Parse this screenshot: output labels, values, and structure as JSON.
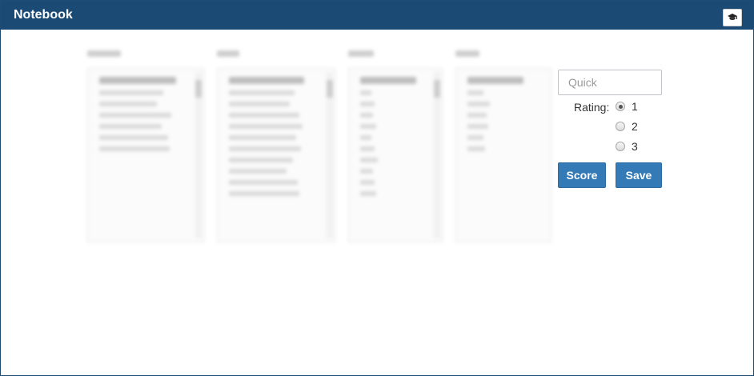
{
  "window": {
    "title": "Notebook"
  },
  "header": {
    "action_icon": "graduation-cap-icon"
  },
  "quick": {
    "placeholder": "Quick",
    "value": ""
  },
  "rating": {
    "label": "Rating:",
    "options": [
      "1",
      "2",
      "3"
    ],
    "selected": "1"
  },
  "buttons": {
    "score": "Score",
    "save": "Save"
  },
  "colors": {
    "titlebar": "#1b4b74",
    "button": "#337ab7"
  }
}
